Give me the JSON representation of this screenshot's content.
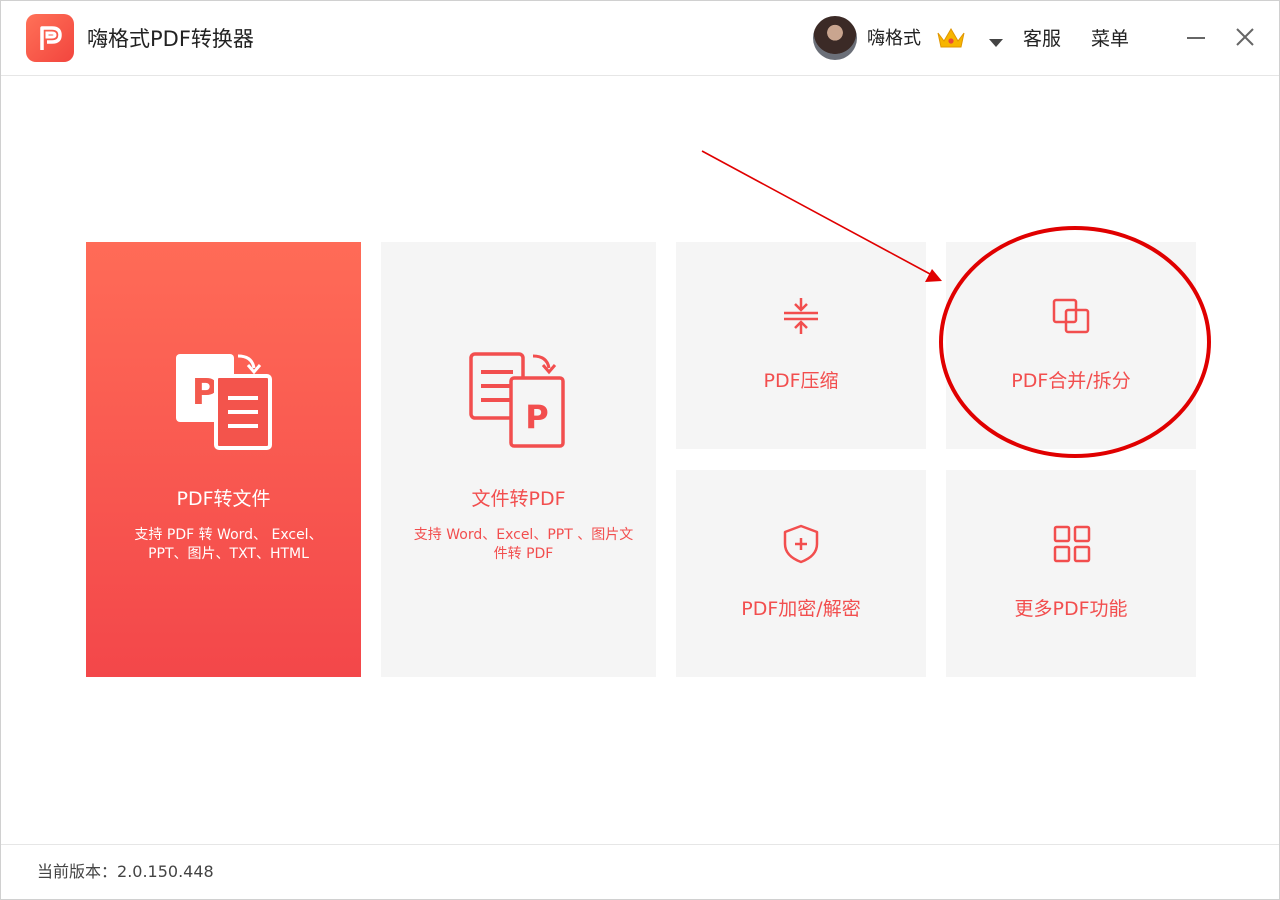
{
  "app": {
    "title": "嗨格式PDF转换器"
  },
  "header": {
    "username": "嗨格式",
    "support": "客服",
    "menu": "菜单"
  },
  "cards": {
    "pdf_to_file": {
      "title": "PDF转文件",
      "desc": "支持 PDF 转 Word、 Excel、 PPT、图片、TXT、HTML"
    },
    "file_to_pdf": {
      "title": "文件转PDF",
      "desc": "支持 Word、Excel、PPT 、图片文件转 PDF"
    },
    "compress": {
      "title": "PDF压缩"
    },
    "merge_split": {
      "title": "PDF合并/拆分"
    },
    "encrypt": {
      "title": "PDF加密/解密"
    },
    "more": {
      "title": "更多PDF功能"
    }
  },
  "footer": {
    "version_label": "当前版本：",
    "version": "2.0.150.448"
  },
  "colors": {
    "accent": "#f24e4e",
    "annotation": "#e00000"
  }
}
